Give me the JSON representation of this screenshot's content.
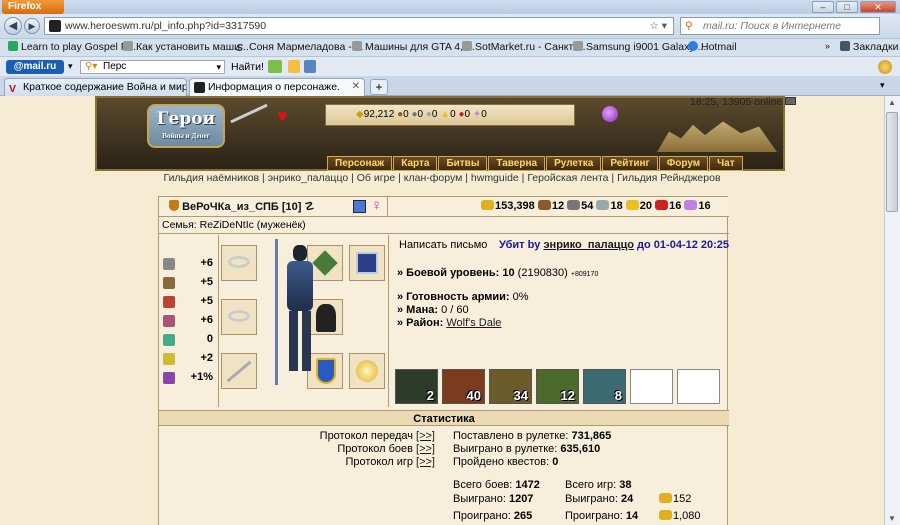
{
  "browser": {
    "firefox_label": "Firefox",
    "url": "www.heroeswm.ru/pl_info.php?id=3317590",
    "search_placeholder": "mail.ru: Поиск в Интернете",
    "bookmarks": [
      {
        "label": "Learn to play Gospel Pi...",
        "icon": "gospel-icon"
      },
      {
        "label": "Как установить маши...",
        "icon": "doc-icon"
      },
      {
        "label": "Соня Мармеладова - ...",
        "icon": "s-icon"
      },
      {
        "label": "Машины для GTA 4, ...",
        "icon": "doc-icon"
      },
      {
        "label": "SotMarket.ru - Санкт-...",
        "icon": "doc-icon"
      },
      {
        "label": "Samsung i9001 Galaxy ...",
        "icon": "doc-icon"
      },
      {
        "label": "Hotmail",
        "icon": "msn-icon"
      }
    ],
    "bookmarks_menu": "Закладки",
    "mail_logo": "@mail.ru",
    "mail_search_value": "Перс",
    "find_label": "Найти!",
    "tabs": [
      {
        "title": "Краткое содержание Война и мир п...",
        "active": false
      },
      {
        "title": "Информация о персонаже.",
        "active": true
      }
    ]
  },
  "game": {
    "logo_title": "Герои",
    "logo_sub": "Войны и Денег",
    "clock": "18:25, 13905 online",
    "top_resources": [
      {
        "icon": "gold-icon",
        "value": "92,212"
      },
      {
        "icon": "wood-icon",
        "value": "0"
      },
      {
        "icon": "ore-icon",
        "value": "0"
      },
      {
        "icon": "mercury-icon",
        "value": "0"
      },
      {
        "icon": "sulfur-icon",
        "value": "0"
      },
      {
        "icon": "crystal-icon",
        "value": "0"
      },
      {
        "icon": "gems-icon",
        "value": "0"
      }
    ],
    "menu": [
      "Персонаж",
      "Карта",
      "Битвы",
      "Таверна",
      "Рулетка",
      "Рейтинг",
      "Форум",
      "Чат"
    ],
    "sublinks": [
      "Гильдия наёмников",
      "энрико_палаццо",
      "Об игре",
      "клан-форум",
      "hwmguide",
      "Геройская лента",
      "Гильдия Рейнджеров"
    ],
    "colors": {
      "gold": "#d4a94a",
      "panel": "#f7efdb",
      "border": "#b09a70"
    }
  },
  "player": {
    "name": "ВеРоЧКа_из_СПБ",
    "level": "[10]",
    "family": "Семья: ReZiDeNtIc (муженёк)",
    "resources": [
      {
        "icon": "gold-icon",
        "value": "153,398",
        "color": "#e0b020"
      },
      {
        "icon": "wood-icon",
        "value": "12",
        "color": "#8a5a2b"
      },
      {
        "icon": "ore-icon",
        "value": "54",
        "color": "#777"
      },
      {
        "icon": "mercury-icon",
        "value": "18",
        "color": "#9aa"
      },
      {
        "icon": "sulfur-icon",
        "value": "20",
        "color": "#e8c020"
      },
      {
        "icon": "crystal-icon",
        "value": "16",
        "color": "#d02020"
      },
      {
        "icon": "gems-icon",
        "value": "16",
        "color": "#c080e0"
      }
    ],
    "stats": [
      {
        "icon": "attack-icon",
        "value": "+6",
        "color": "#888"
      },
      {
        "icon": "defense-icon",
        "value": "+5",
        "color": "#8a6a3a"
      },
      {
        "icon": "spellpower-icon",
        "value": "+5",
        "color": "#b43"
      },
      {
        "icon": "knowledge-icon",
        "value": "+6",
        "color": "#a57"
      },
      {
        "icon": "luck-icon",
        "value": "0",
        "color": "#4a8"
      },
      {
        "icon": "morale-icon",
        "value": "+2",
        "color": "#cb3"
      },
      {
        "icon": "initiative-icon",
        "value": "+1%",
        "color": "#84a"
      }
    ],
    "write_letter": "Написать письмо",
    "killed_by_prefix": "Убит by",
    "killed_by_name": "энрико_палаццо",
    "killed_by_date": "до 01-04-12 20:25",
    "combat_level_label": "» Боевой уровень:",
    "combat_level_value": "10",
    "combat_level_exp": "(2190830)",
    "combat_level_extra": "+809170",
    "army_ready_label": "» Готовность армии:",
    "army_ready_value": "0%",
    "mana_label": "» Мана:",
    "mana_value": "0 / 60",
    "district_label": "» Район:",
    "district_value": "Wolf's Dale",
    "army": [
      {
        "count": "2",
        "color": "#2d3b2a"
      },
      {
        "count": "40",
        "color": "#7a3b1f"
      },
      {
        "count": "34",
        "color": "#6b5a2a"
      },
      {
        "count": "12",
        "color": "#4d6a2d"
      },
      {
        "count": "8",
        "color": "#3c6a72"
      },
      {
        "count": "",
        "color": "#ffffff"
      },
      {
        "count": "",
        "color": "#ffffff"
      }
    ]
  },
  "statistics": {
    "header": "Статистика",
    "protocols": [
      {
        "label": "Протокол передач",
        "link": "[>>]"
      },
      {
        "label": "Протокол боев",
        "link": "[>>]"
      },
      {
        "label": "Протокол игр",
        "link": "[>>]"
      }
    ],
    "roulette_placed_label": "Поставлено в рулетке:",
    "roulette_placed_value": "731,865",
    "roulette_won_label": "Выиграно в рулетке:",
    "roulette_won_value": "635,610",
    "quests_label": "Пройдено квестов:",
    "quests_value": "0",
    "battles_total_label": "Всего боев:",
    "battles_total_value": "1472",
    "battles_won_label": "Выиграно:",
    "battles_won_value": "1207",
    "battles_lost_label": "Проиграно:",
    "battles_lost_value": "265",
    "games_total_label": "Всего игр:",
    "games_total_value": "38",
    "games_won_label": "Выиграно:",
    "games_won_value": "24",
    "games_won_gold": "152",
    "games_lost_label": "Проиграно:",
    "games_lost_value": "14",
    "games_lost_gold": "1,080"
  }
}
